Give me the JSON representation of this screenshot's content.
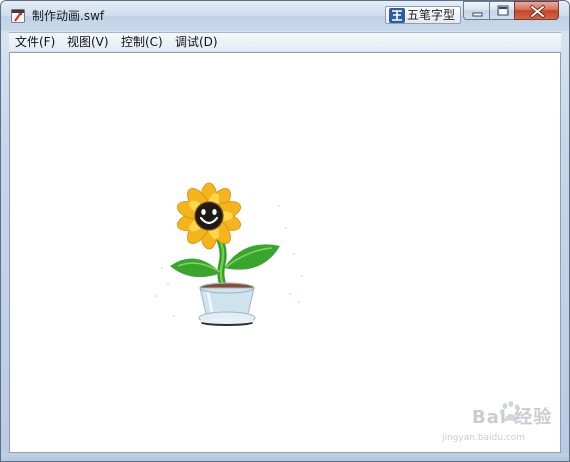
{
  "window": {
    "title": "制作动画.swf",
    "app_icon": "flash-player-icon"
  },
  "ime": {
    "label": "五笔字型",
    "icon": "wubi-ime-icon"
  },
  "controls": {
    "minimize_icon": "minimize-icon",
    "maximize_icon": "maximize-icon",
    "close_icon": "close-icon"
  },
  "menu": {
    "items": [
      {
        "label": "文件(F)"
      },
      {
        "label": "视图(V)"
      },
      {
        "label": "控制(C)"
      },
      {
        "label": "调试(D)"
      }
    ]
  },
  "content": {
    "animation": "sunflower-in-pot",
    "watermark_text": "Bai 经验",
    "watermark_url": "jingyan.baidu.com"
  },
  "colors": {
    "close_red": "#c5452b",
    "petal_yellow": "#f3b51b",
    "leaf_green": "#3aa52e",
    "pot_blue": "#cfe3ee"
  }
}
